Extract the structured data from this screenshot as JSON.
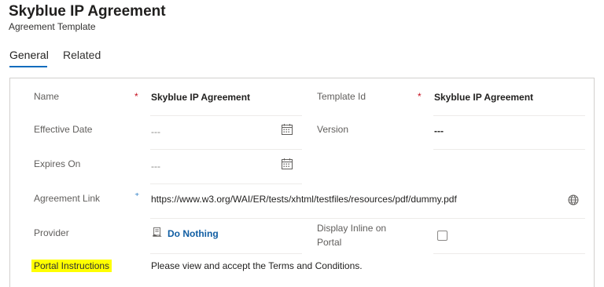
{
  "header": {
    "title": "Skyblue IP Agreement",
    "subtitle": "Agreement Template"
  },
  "tabs": [
    {
      "label": "General",
      "selected": true
    },
    {
      "label": "Related",
      "selected": false
    }
  ],
  "form": {
    "name_label": "Name",
    "name_value": "Skyblue IP Agreement",
    "template_id_label": "Template Id",
    "template_id_value": "Skyblue IP Agreement",
    "effective_date_label": "Effective Date",
    "effective_date_value": "---",
    "version_label": "Version",
    "version_value": "---",
    "expires_on_label": "Expires On",
    "expires_on_value": "---",
    "agreement_link_label": "Agreement Link",
    "agreement_link_value": "https://www.w3.org/WAI/ER/tests/xhtml/testfiles/resources/pdf/dummy.pdf",
    "provider_label": "Provider",
    "provider_value": "Do Nothing",
    "display_inline_label_line1": "Display Inline on",
    "display_inline_label_line2": "Portal",
    "display_inline_checked": false,
    "portal_instructions_label": "Portal Instructions",
    "portal_instructions_value": "Please view and accept the Terms and Conditions.",
    "required_marker": "*",
    "recommended_marker": "⁺"
  },
  "colors": {
    "accent": "#0f6cbd",
    "required": "#c50f1f",
    "highlight": "#ffff00",
    "link": "#115ea3"
  },
  "icons": {
    "date_picker": "calendar-icon",
    "url": "globe-icon",
    "lookup": "entity-record-icon"
  }
}
